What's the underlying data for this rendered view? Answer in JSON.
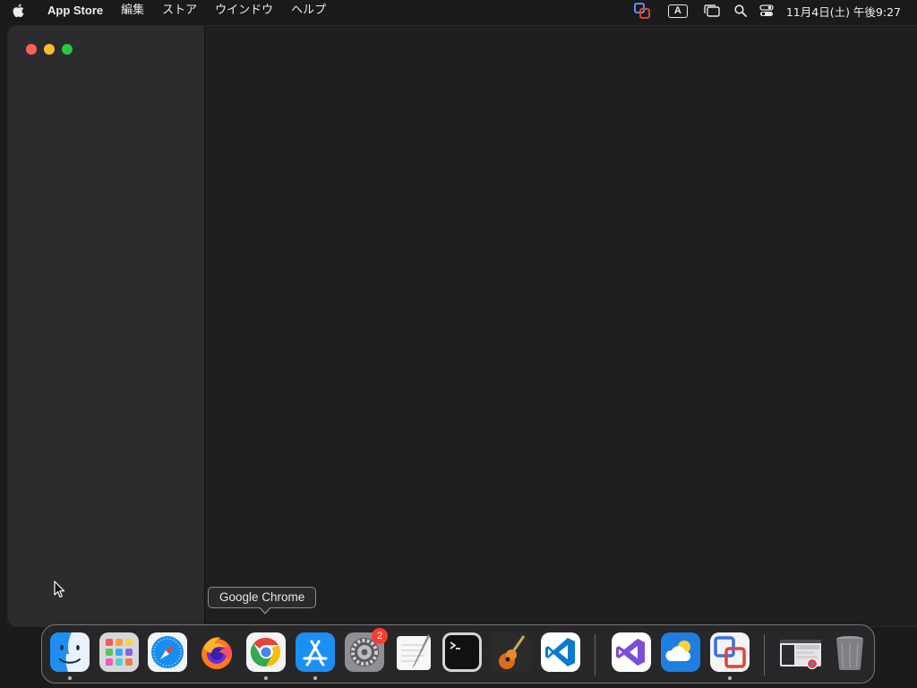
{
  "menubar": {
    "app_name": "App Store",
    "items": [
      {
        "label": "編集"
      },
      {
        "label": "ストア"
      },
      {
        "label": "ウインドウ"
      },
      {
        "label": "ヘルプ"
      }
    ],
    "input_mode": "A",
    "clock": "11月4日(土) 午後9:27",
    "status_icons": [
      "screen-share-icon",
      "input-source-icon",
      "window-stack-icon",
      "spotlight-search-icon",
      "control-center-icon"
    ]
  },
  "tooltip": {
    "text": "Google Chrome"
  },
  "dock": {
    "apps": [
      {
        "name": "Finder",
        "icon": "finder-icon",
        "running": true
      },
      {
        "name": "Launchpad",
        "icon": "launchpad-icon",
        "running": false
      },
      {
        "name": "Safari",
        "icon": "safari-icon",
        "running": false
      },
      {
        "name": "Firefox",
        "icon": "firefox-icon",
        "running": false
      },
      {
        "name": "Google Chrome",
        "icon": "chrome-icon",
        "running": true
      },
      {
        "name": "App Store",
        "icon": "app-store-icon",
        "running": true
      },
      {
        "name": "System Settings",
        "icon": "system-settings-icon",
        "running": false,
        "badge": "2"
      },
      {
        "name": "TextEdit",
        "icon": "textedit-icon",
        "running": false
      },
      {
        "name": "Terminal",
        "icon": "terminal-icon",
        "running": false
      },
      {
        "name": "GarageBand",
        "icon": "garageband-icon",
        "running": false
      },
      {
        "name": "Visual Studio Code",
        "icon": "vscode-icon",
        "running": false
      },
      {
        "name": "Visual Studio",
        "icon": "visual-studio-icon",
        "running": false
      },
      {
        "name": "Weather",
        "icon": "weather-icon",
        "running": false
      },
      {
        "name": "Screen Sharing",
        "icon": "screen-sharing-icon",
        "running": true
      },
      {
        "name": "Recent Window",
        "icon": "window-thumbnail-icon",
        "running": false
      },
      {
        "name": "Trash",
        "icon": "trash-icon",
        "running": false
      }
    ]
  },
  "colors": {
    "close": "#ff5f57",
    "minimize": "#febc2e",
    "zoom": "#28c840",
    "badge": "#ff3b30"
  }
}
